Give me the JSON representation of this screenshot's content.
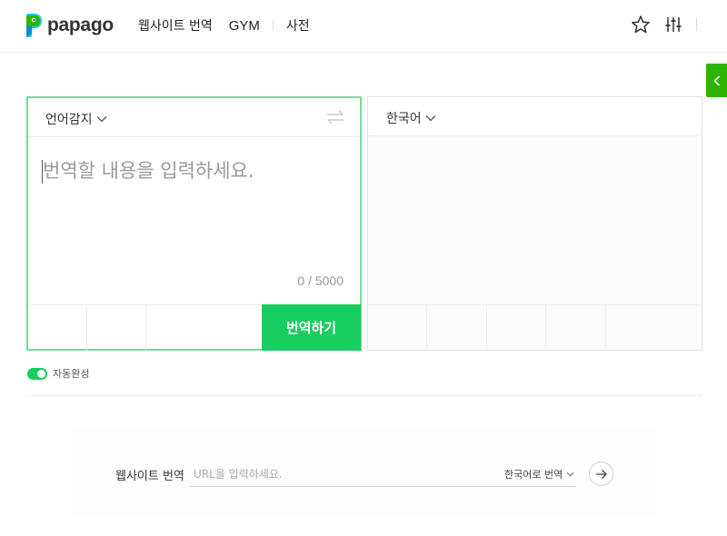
{
  "header": {
    "logo_text": "papago",
    "nav": [
      {
        "label": "웹사이트 번역"
      },
      {
        "label": "GYM"
      },
      {
        "label": "사전"
      }
    ]
  },
  "source": {
    "language": "언어감지",
    "placeholder": "번역할 내용을 입력하세요.",
    "counter": "0 / 5000",
    "translate_label": "번역하기"
  },
  "target": {
    "language": "한국어"
  },
  "autocomplete": {
    "label": "자동완성",
    "enabled": true
  },
  "website_translate": {
    "label": "웹사이트 번역",
    "placeholder": "URL을 입력하세요.",
    "target_language": "한국어로 번역"
  },
  "colors": {
    "accent": "#19ce60",
    "brand": "#2db400",
    "panel_border": "#7ed79a"
  },
  "icons": [
    "papago-logo-icon",
    "star-icon",
    "settings-sliders-icon",
    "chevron-left-icon",
    "chevron-down-icon",
    "swap-icon",
    "arrow-right-icon"
  ]
}
